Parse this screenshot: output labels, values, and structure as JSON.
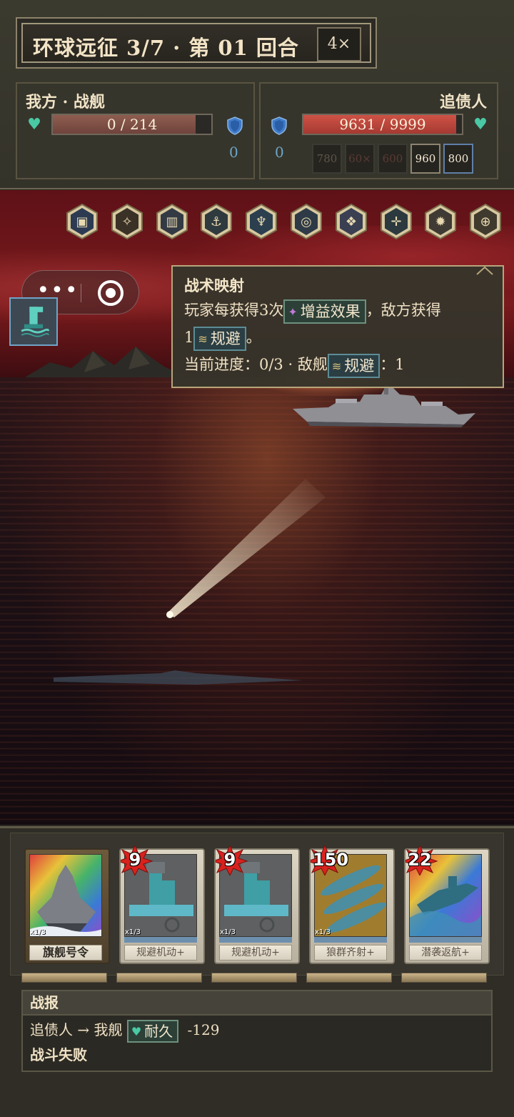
{
  "hud": {
    "title": "环球远征 3/7 · 第 01 回合",
    "speed": "4×"
  },
  "ally": {
    "name": "我方 · 战舰",
    "hp_text": "0 / 214",
    "hp_fraction": 0.0,
    "armor": "0"
  },
  "enemy": {
    "name": "追债人",
    "hp_text": "9631 / 9999",
    "hp_fraction": 0.963,
    "armor": "0",
    "intents": [
      "780",
      "60×",
      "600",
      "960",
      "800"
    ]
  },
  "scene": {
    "relic_icons": [
      "shield-emblem-icon",
      "sextant-icon",
      "armor-plate-icon",
      "anchor-staff-icon",
      "trident-icon",
      "horn-icon",
      "wing-icon",
      "compass-icon",
      "cannon-icon",
      "clock-dial-icon"
    ],
    "buff_icon": "periscope-icon",
    "tooltip": {
      "title": "战术映射",
      "line1_a": "玩家每获得3次",
      "line1_kw": "增益效果",
      "line1_b": "，敌方获得",
      "line2_a": "1",
      "line2_kw": "规避",
      "line2_b": "。",
      "line3_a": "当前进度：0/3 · 敌舰",
      "line3_kw": "规避",
      "line3_b": "：1"
    }
  },
  "hand": [
    {
      "name": "旗舰号令",
      "cost": "",
      "tier": "x1/3",
      "art": "battleship"
    },
    {
      "name": "规避机动+",
      "cost": "9",
      "tier": "x1/3",
      "art": "engine"
    },
    {
      "name": "规避机动+",
      "cost": "9",
      "tier": "x1/3",
      "art": "engine"
    },
    {
      "name": "狼群齐射+",
      "cost": "150",
      "tier": "x1/3",
      "art": "torpedo"
    },
    {
      "name": "潜袭返航+",
      "cost": "22",
      "tier": "",
      "art": "submarine"
    }
  ],
  "log": {
    "header": "战报",
    "line1_a": "追债人 → 我舰",
    "line1_kw": "耐久",
    "line1_b": "-129",
    "line2": "战斗失败"
  },
  "colors": {
    "ally_hp": "#8a5a4f",
    "enemy_hp": "#c0473d",
    "heart": "#49c9a4",
    "shield": "#3f7bc9",
    "gold_border": "#b7a57a"
  }
}
